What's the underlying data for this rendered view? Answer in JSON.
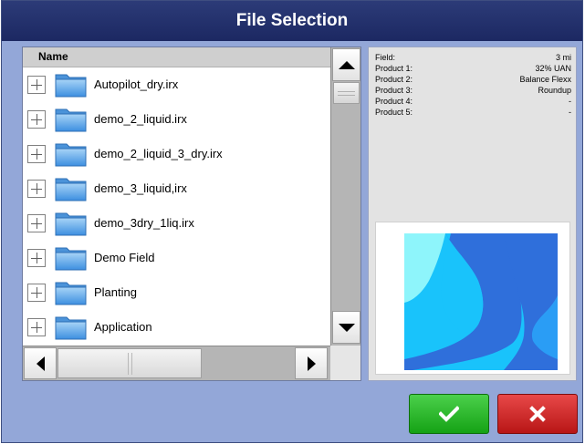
{
  "dialog": {
    "title": "File Selection"
  },
  "file_list": {
    "header": "Name",
    "items": [
      {
        "label": "Autopilot_dry.irx"
      },
      {
        "label": "demo_2_liquid.irx"
      },
      {
        "label": "demo_2_liquid_3_dry.irx"
      },
      {
        "label": "demo_3_liquid,irx"
      },
      {
        "label": "demo_3dry_1liq.irx"
      },
      {
        "label": "Demo Field"
      },
      {
        "label": "Planting"
      },
      {
        "label": "Application"
      }
    ]
  },
  "details": {
    "rows": [
      {
        "key": "Field:",
        "value": "3 mi"
      },
      {
        "key": "Product 1:",
        "value": "32% UAN"
      },
      {
        "key": "Product 2:",
        "value": "Balance Flexx"
      },
      {
        "key": "Product 3:",
        "value": "Roundup"
      },
      {
        "key": "Product 4:",
        "value": "-"
      },
      {
        "key": "Product 5:",
        "value": "-"
      }
    ]
  },
  "icons": {
    "ok": "checkmark-icon",
    "cancel": "x-icon",
    "expand": "plus-expander-icon",
    "folder": "folder-icon"
  },
  "colors": {
    "title_bar": "#1f2b66",
    "dialog_bg": "#93a7d8",
    "ok_button": "#22b022",
    "cancel_button": "#cc2222",
    "map_zone_light": "#8ef5fb",
    "map_zone_cyan": "#19c3fb",
    "map_zone_blue": "#2f6fdb",
    "map_zone_mid": "#2a9df5"
  }
}
